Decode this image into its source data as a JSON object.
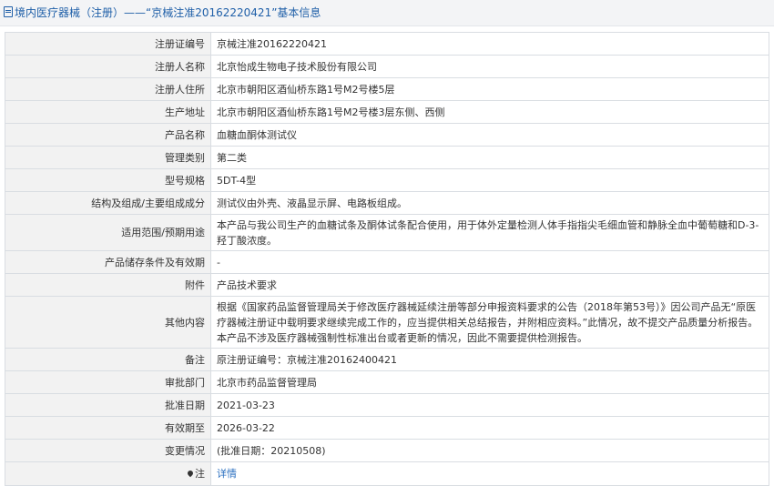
{
  "header": {
    "title": "境内医疗器械（注册）——“京械注准20162220421”基本信息"
  },
  "rows": [
    {
      "label": "注册证编号",
      "value": "京械注准20162220421"
    },
    {
      "label": "注册人名称",
      "value": "北京怡成生物电子技术股份有限公司"
    },
    {
      "label": "注册人住所",
      "value": "北京市朝阳区酒仙桥东路1号M2号楼5层"
    },
    {
      "label": "生产地址",
      "value": "北京市朝阳区酒仙桥东路1号M2号楼3层东侧、西侧"
    },
    {
      "label": "产品名称",
      "value": "血糖血酮体测试仪"
    },
    {
      "label": "管理类别",
      "value": "第二类"
    },
    {
      "label": "型号规格",
      "value": "5DT-4型"
    },
    {
      "label": "结构及组成/主要组成成分",
      "value": "测试仪由外壳、液晶显示屏、电路板组成。"
    },
    {
      "label": "适用范围/预期用途",
      "value": "本产品与我公司生产的血糖试条及酮体试条配合使用，用于体外定量检测人体手指指尖毛细血管和静脉全血中葡萄糖和D-3-羟丁酸浓度。"
    },
    {
      "label": "产品储存条件及有效期",
      "value": "-"
    },
    {
      "label": "附件",
      "value": "产品技术要求"
    },
    {
      "label": "其他内容",
      "value": "根据《国家药品监督管理局关于修改医疗器械延续注册等部分申报资料要求的公告（2018年第53号）》因公司产品无“原医疗器械注册证中载明要求继续完成工作的，应当提供相关总结报告，并附相应资料。”此情况，故不提交产品质量分析报告。 本产品不涉及医疗器械强制性标准出台或者更新的情况，因此不需要提供检测报告。"
    },
    {
      "label": "备注",
      "value": "原注册证编号：京械注准20162400421"
    },
    {
      "label": "审批部门",
      "value": "北京市药品监督管理局"
    },
    {
      "label": "批准日期",
      "value": "2021-03-23"
    },
    {
      "label": "有效期至",
      "value": "2026-03-22"
    },
    {
      "label": "变更情况",
      "value": "(批准日期：20210508)"
    }
  ],
  "note": {
    "label": "注",
    "link_text": "详情"
  },
  "colors": {
    "title": "#1f5fa8",
    "link": "#2a6fc0",
    "label_bg": "#f2f2f2",
    "border": "#d9dde2"
  }
}
